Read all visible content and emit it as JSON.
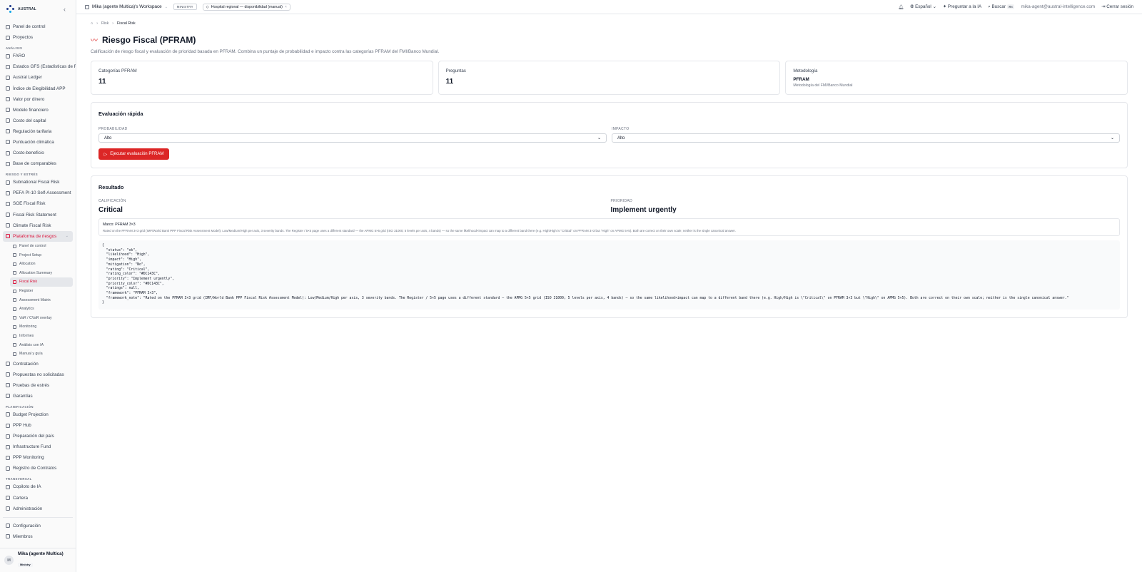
{
  "brand": {
    "name": "AUSTRAL"
  },
  "topbar": {
    "workspace": "Mika (agente Multica)'s Workspace",
    "tier": "MINISTRY",
    "project": "Hospital regional — disponibilidad (manual)",
    "language": "Español",
    "ask_ai": "Preguntar a la IA",
    "search": "Buscar",
    "search_kbd": "⌘K",
    "email": "mika-agent@austral-intelligence.com",
    "logout": "Cerrar sesión"
  },
  "sidebar": {
    "top": [
      "Panel de control",
      "Proyectos"
    ],
    "sections": [
      {
        "title": "ANÁLISIS",
        "items": [
          "FARO",
          "Estados GFS (Estadísticas de Finanzas Públicas)",
          "Austral Ledger",
          "Índice de Elegibilidad APP",
          "Valor por dinero",
          "Modelo financiero",
          "Costo del capital",
          "Regulación tarifaria",
          "Puntuación climática",
          "Costo-beneficio",
          "Base de comparables"
        ]
      },
      {
        "title": "RIESGO Y ESTRÉS",
        "items": [
          "Subnational Fiscal Risk",
          "PEFA PI-10 Self-Assessment",
          "SOE Fiscal Risk",
          "Fiscal Risk Statement",
          "Climate Fiscal Risk",
          "Plataforma de riesgos"
        ]
      }
    ],
    "risk_sub": [
      "Panel de control",
      "Project Setup",
      "Allocation",
      "Allocation Summary",
      "Fiscal Risk",
      "Register",
      "Assessment Matrix",
      "Analytics",
      "VaR / CVaR overlay",
      "Monitoring",
      "Informes",
      "Análisis con IA",
      "Manual y guía"
    ],
    "after_risk": [
      "Contratación",
      "Propuestas no solicitadas",
      "Pruebas de estrés",
      "Garantías"
    ],
    "planning_title": "PLANIFICACIÓN",
    "planning": [
      "Budget Projection",
      "PPP Hub",
      "Preparación del país",
      "Infrastructure Fund",
      "PPP Monitoring",
      "Registro de Contratos"
    ],
    "transversal_title": "TRANSVERSAL",
    "transversal": [
      "Copiloto de IA",
      "Cartera",
      "Administración"
    ],
    "bottom": [
      "Configuración",
      "Miembros"
    ],
    "user": {
      "initial": "M",
      "name": "Mika (agente Multica)",
      "badge": "Ministry"
    }
  },
  "breadcrumb": [
    "Risk",
    "Fiscal Risk"
  ],
  "page": {
    "title": "Riesgo Fiscal (PFRAM)",
    "subtitle": "Calificación de riesgo fiscal y evaluación de prioridad basada en PFRAM. Combina un puntaje de probabilidad e impacto contra las categorías PFRAM del FMI/Banco Mundial."
  },
  "cards": {
    "categories_label": "Categorías PFRAM",
    "categories_value": "11",
    "questions_label": "Preguntas",
    "questions_value": "11",
    "method_label": "Metodología",
    "method_value": "PFRAM",
    "method_sub": "Metodología del FMI/Banco Mundial"
  },
  "quick": {
    "title": "Evaluación rápida",
    "prob_label": "PROBABILIDAD",
    "prob_value": "Alto",
    "impact_label": "IMPACTO",
    "impact_value": "Alto",
    "run_button": "Ejecutar evaluación PFRAM"
  },
  "result": {
    "title": "Resultado",
    "rating_label": "CALIFICACIÓN",
    "rating_value": "Critical",
    "priority_label": "PRIORIDAD",
    "priority_value": "Implement urgently",
    "framework_title": "Marco: PFRAM 3×3",
    "framework_note": "Rated on the PFRAM 3×3 grid (IMF/World Bank PPP Fiscal Risk Assessment Model): Low/Medium/High per axis, 3 severity bands. The Register / 5×5 page uses a different standard — the APMG 5×5 grid (ISO 31000; 5 levels per axis, 4 bands) — so the same likelihood×impact can map to a different band there (e.g. High/High is \"Critical\" on PFRAM 3×3 but \"High\" on APMG 5×5). Both are correct on their own scale; neither is the single canonical answer.",
    "json_text": "{\n  \"status\": \"ok\",\n  \"likelihood\": \"High\",\n  \"impact\": \"High\",\n  \"mitigation\": \"No\",\n  \"rating\": \"Critical\",\n  \"rating_color\": \"#DC143C\",\n  \"priority\": \"Implement urgently\",\n  \"priority_color\": \"#DC143C\",\n  \"ratings\": null,\n  \"framework\": \"PFRAM 3×3\",\n  \"framework_note\": \"Rated on the PFRAM 3×3 grid (IMF/World Bank PPP Fiscal Risk Assessment Model): Low/Medium/High per axis, 3 severity bands. The Register / 5×5 page uses a different standard — the APMG 5×5 grid (ISO 31000; 5 levels per axis, 4 bands) — so the same likelihood×impact can map to a different band there (e.g. High/High is \\\"Critical\\\" on PFRAM 3×3 but \\\"High\\\" on APMG 5×5). Both are correct on their own scale; neither is the single canonical answer.\"\n}"
  },
  "colors": {
    "accent": "#dc2626",
    "crimson": "#DC143C"
  }
}
